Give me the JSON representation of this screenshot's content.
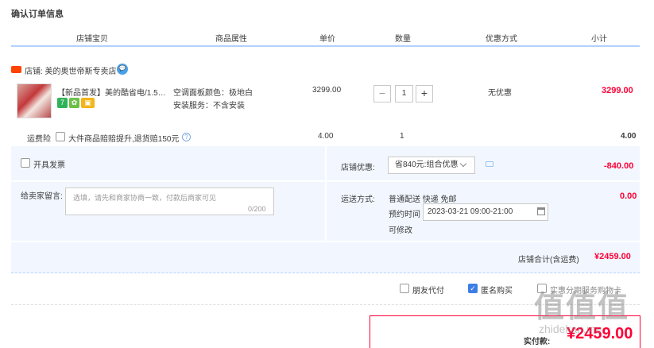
{
  "page_title": "确认订单信息",
  "columns": [
    "店铺宝贝",
    "商品属性",
    "单价",
    "数量",
    "优惠方式",
    "小计"
  ],
  "shop": {
    "badge": "天猫",
    "name": "店铺: 美的奥世帝斯专卖店"
  },
  "item": {
    "title": "【新品首发】美的酷省电/1.5匹...",
    "props": [
      "空调面板颜色：极地白",
      "安装服务：不含安装"
    ],
    "price": "3299.00",
    "quantity": "1",
    "minus": "−",
    "plus": "+",
    "discount": "无优惠",
    "subtotal": "3299.00",
    "tags": [
      "7",
      "✿",
      "▣"
    ]
  },
  "insurance": {
    "label": "运费险",
    "text": "大件商品赔赔提升,退货赔150元",
    "price": "4.00",
    "qty": "1",
    "subtotal": "4.00"
  },
  "invoice": {
    "label": "开具发票"
  },
  "message": {
    "label": "给卖家留言:",
    "placeholder": "选填，请先和商家协商一致，付款后商家可见",
    "count": "0/200"
  },
  "shop_discount": {
    "label": "店铺优惠:",
    "value": "省840元:组合优惠",
    "amount": "-840.00"
  },
  "shipping": {
    "label": "运送方式:",
    "method": "普通配送 快递 免邮",
    "reserve_label": "预约时间",
    "reserve_value": "2023-03-21 09:00-21:00",
    "modify": "可修改",
    "amount": "0.00"
  },
  "shop_total": {
    "label": "店铺合计(含运费)",
    "value": "¥2459.00"
  },
  "options": {
    "friend_pay": "朋友代付",
    "anonymous": "匿名购买",
    "third": "实惠分期服务购物卡"
  },
  "pay": {
    "label": "实付款:",
    "value": "¥2459.00"
  },
  "watermark": {
    "logo": "值值值",
    "url": "zhidekan.me"
  },
  "colors": {
    "accent": "#ff0036",
    "blue": "#3d7de6",
    "panel": "#f2f7ff"
  }
}
